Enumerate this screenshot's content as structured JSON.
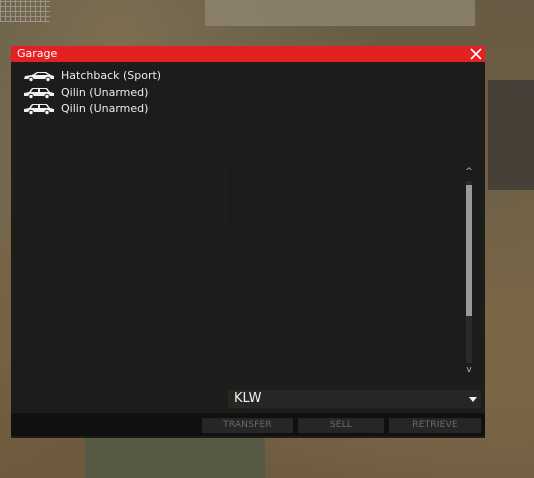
{
  "window": {
    "title": "Garage",
    "close_icon": "close-icon",
    "accent_color": "#e52020"
  },
  "vehicles": [
    {
      "label": "Hatchback (Sport)",
      "icon": "hatchback-car-icon"
    },
    {
      "label": "Qilin (Unarmed)",
      "icon": "suv-car-icon"
    },
    {
      "label": "Qilin (Unarmed)",
      "icon": "suv-car-icon"
    }
  ],
  "dropdown": {
    "selected": "KLW",
    "icon": "chevron-down-icon"
  },
  "scrollbar": {
    "up_glyph": "^",
    "down_glyph": "v"
  },
  "buttons": {
    "transfer": "TRANSFER",
    "sell": "SELL",
    "retrieve": "RETRIEVE"
  }
}
